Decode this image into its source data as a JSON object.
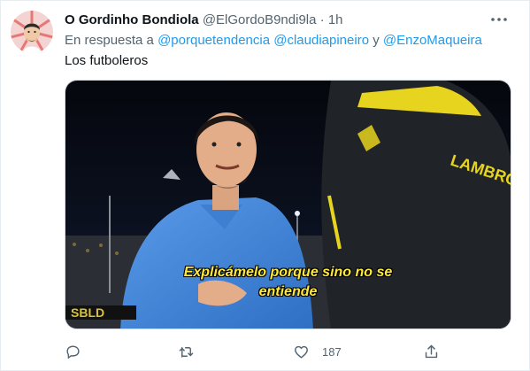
{
  "author": {
    "name": "O Gordinho Bondiola",
    "handle": "@ElGordoB9ndi9la",
    "separator": "·",
    "time": "1h"
  },
  "reply_context": {
    "prefix": "En respuesta a",
    "mentions": [
      "@porquetendencia",
      "@claudiapineiro"
    ],
    "conjunction": "y",
    "last_mention": "@EnzoMaqueira"
  },
  "tweet_text": "Los futboleros",
  "media": {
    "subtitle_line1": "Explicámelo porque sino no se",
    "subtitle_line2": "entiende",
    "jersey_text": "LAMBRO"
  },
  "actions": {
    "reply_count": "",
    "retweet_count": "",
    "like_count": "187"
  },
  "icons": {
    "reply": "reply-icon",
    "retweet": "retweet-icon",
    "like": "heart-icon",
    "share": "share-icon",
    "more": "more-icon"
  },
  "colors": {
    "accent": "#1d9bf0",
    "secondary_text": "#536471",
    "subtitle": "#ffe93a"
  }
}
